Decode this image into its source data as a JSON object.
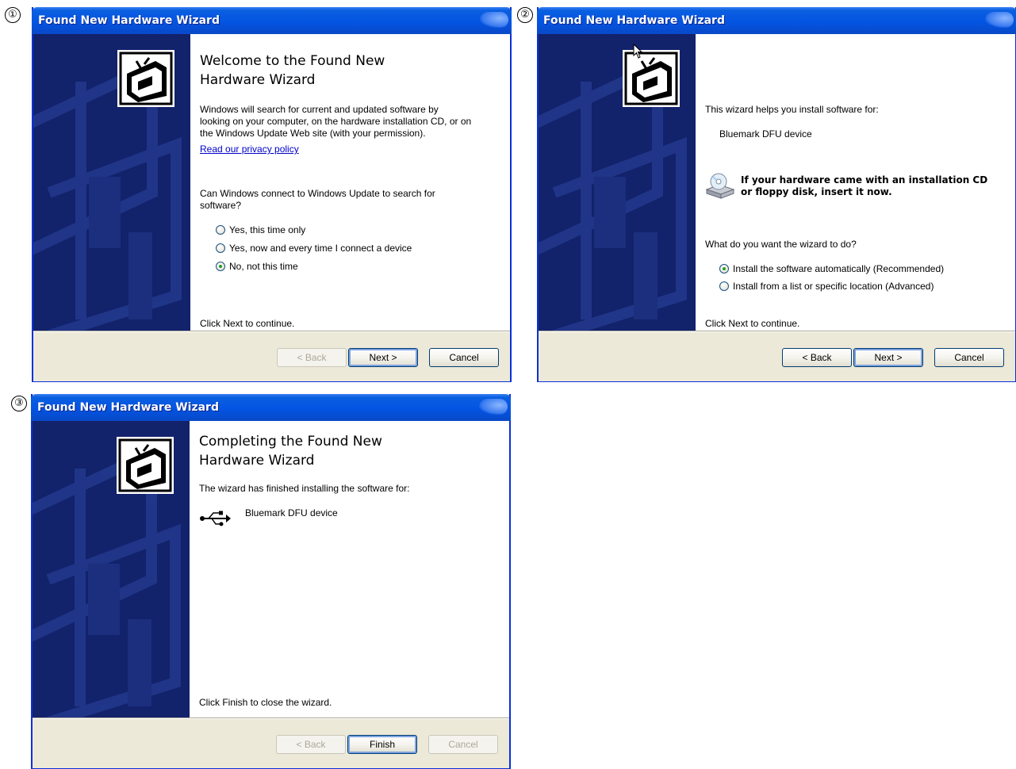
{
  "panels": [
    {
      "step": "①",
      "title": "Found New Hardware Wizard",
      "heading_line1": "Welcome to the Found New",
      "heading_line2": "Hardware Wizard",
      "intro_line1": "Windows will search for current and updated software by",
      "intro_line2": "looking on your computer, on the hardware installation CD, or on",
      "intro_line3": "the Windows Update Web site (with your permission).",
      "privacy_link": "Read our privacy policy",
      "question_line1": "Can Windows connect to Windows Update to search for",
      "question_line2": "software?",
      "options": [
        {
          "label": "Yes, this time only",
          "selected": false
        },
        {
          "label": "Yes, now and every time I connect a device",
          "selected": false
        },
        {
          "label": "No, not this time",
          "selected": true
        }
      ],
      "footer_text": "Click Next to continue.",
      "back_label": "< Back",
      "back_enabled": false,
      "next_label": "Next >",
      "cancel_label": "Cancel"
    },
    {
      "step": "②",
      "title": "Found New Hardware Wizard",
      "intro": "This wizard helps you install software for:",
      "device": "Bluemark DFU device",
      "cd_line1": "If your hardware came with an installation CD",
      "cd_line2": "or floppy disk, insert it now.",
      "question": "What do you want the wizard to do?",
      "options": [
        {
          "label": "Install the software automatically (Recommended)",
          "selected": true
        },
        {
          "label": "Install from a list or specific location (Advanced)",
          "selected": false
        }
      ],
      "footer_text": "Click Next to continue.",
      "back_label": "< Back",
      "back_enabled": true,
      "next_label": "Next >",
      "cancel_label": "Cancel"
    },
    {
      "step": "③",
      "title": "Found New Hardware Wizard",
      "heading_line1": "Completing the Found New",
      "heading_line2": "Hardware Wizard",
      "intro": "The wizard has finished installing the software for:",
      "device": "Bluemark DFU device",
      "footer_text": "Click Finish to close the wizard.",
      "back_label": "< Back",
      "back_enabled": false,
      "finish_label": "Finish",
      "cancel_label": "Cancel",
      "cancel_enabled": false
    }
  ],
  "icons": {
    "hardware": "hardware-wizard-icon",
    "cd": "cd-drive-icon",
    "usb": "usb-icon"
  },
  "colors": {
    "title_bar": "#0454e2",
    "side_panel": "#12226b",
    "link": "#0000cc",
    "radio_dot": "#21a121"
  }
}
